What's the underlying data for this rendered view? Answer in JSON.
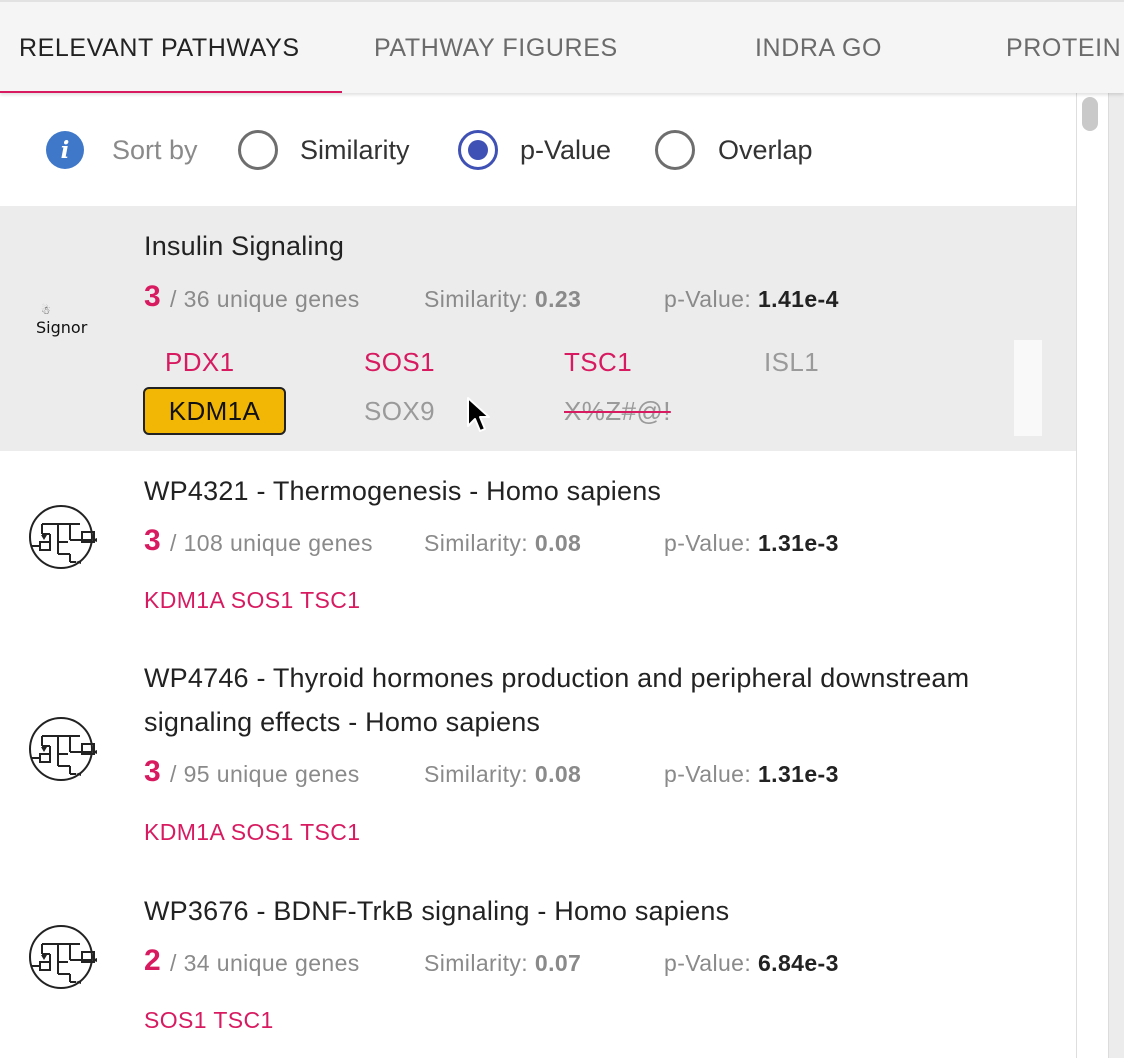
{
  "tabs": [
    {
      "label": "RELEVANT PATHWAYS",
      "active": true
    },
    {
      "label": "PATHWAY FIGURES",
      "active": false
    },
    {
      "label": "INDRA GO",
      "active": false
    },
    {
      "label": "PROTEIN",
      "active": false
    }
  ],
  "sort": {
    "info_icon": "info-icon",
    "label": "Sort by",
    "options": [
      {
        "label": "Similarity",
        "checked": false
      },
      {
        "label": "p-Value",
        "checked": true
      },
      {
        "label": "Overlap",
        "checked": false
      }
    ]
  },
  "colors": {
    "accent": "#d81b60",
    "radio_selected": "#3f51b5",
    "info": "#3f78c9",
    "highlight_gene": "#f2b705",
    "selected_row": "#ececec"
  },
  "results": [
    {
      "source_logo": "Signor",
      "title": "Insulin Signaling",
      "overlap": "3",
      "total": "/ 36 unique genes",
      "similarity_label": "Similarity:",
      "similarity": "0.23",
      "pvalue_label": "p-Value:",
      "pvalue": "1.41e-4",
      "selected": true,
      "genes": [
        {
          "name": "PDX1",
          "state": "overlap"
        },
        {
          "name": "SOS1",
          "state": "overlap"
        },
        {
          "name": "TSC1",
          "state": "overlap"
        },
        {
          "name": "ISL1",
          "state": "not-in-query"
        },
        {
          "name": "KDM1A",
          "state": "highlighted"
        },
        {
          "name": "SOX9",
          "state": "not-in-query"
        },
        {
          "name": "X%Z#@!",
          "state": "unrecognized"
        }
      ]
    },
    {
      "source_logo": "wikipathways-icon",
      "title": "WP4321 - Thermogenesis - Homo sapiens",
      "overlap": "3",
      "total": "/ 108 unique genes",
      "similarity_label": "Similarity:",
      "similarity": "0.08",
      "pvalue_label": "p-Value:",
      "pvalue": "1.31e-3",
      "genes_text": "KDM1A SOS1 TSC1"
    },
    {
      "source_logo": "wikipathways-icon",
      "title_line1": "WP4746 - Thyroid hormones production and peripheral downstream",
      "title_line2": "signaling effects - Homo sapiens",
      "overlap": "3",
      "total": "/ 95 unique genes",
      "similarity_label": "Similarity:",
      "similarity": "0.08",
      "pvalue_label": "p-Value:",
      "pvalue": "1.31e-3",
      "genes_text": "KDM1A SOS1 TSC1"
    },
    {
      "source_logo": "wikipathways-icon",
      "title": "WP3676 - BDNF-TrkB signaling - Homo sapiens",
      "overlap": "2",
      "total": "/ 34 unique genes",
      "similarity_label": "Similarity:",
      "similarity": "0.07",
      "pvalue_label": "p-Value:",
      "pvalue": "6.84e-3",
      "genes_text": "SOS1 TSC1"
    }
  ]
}
